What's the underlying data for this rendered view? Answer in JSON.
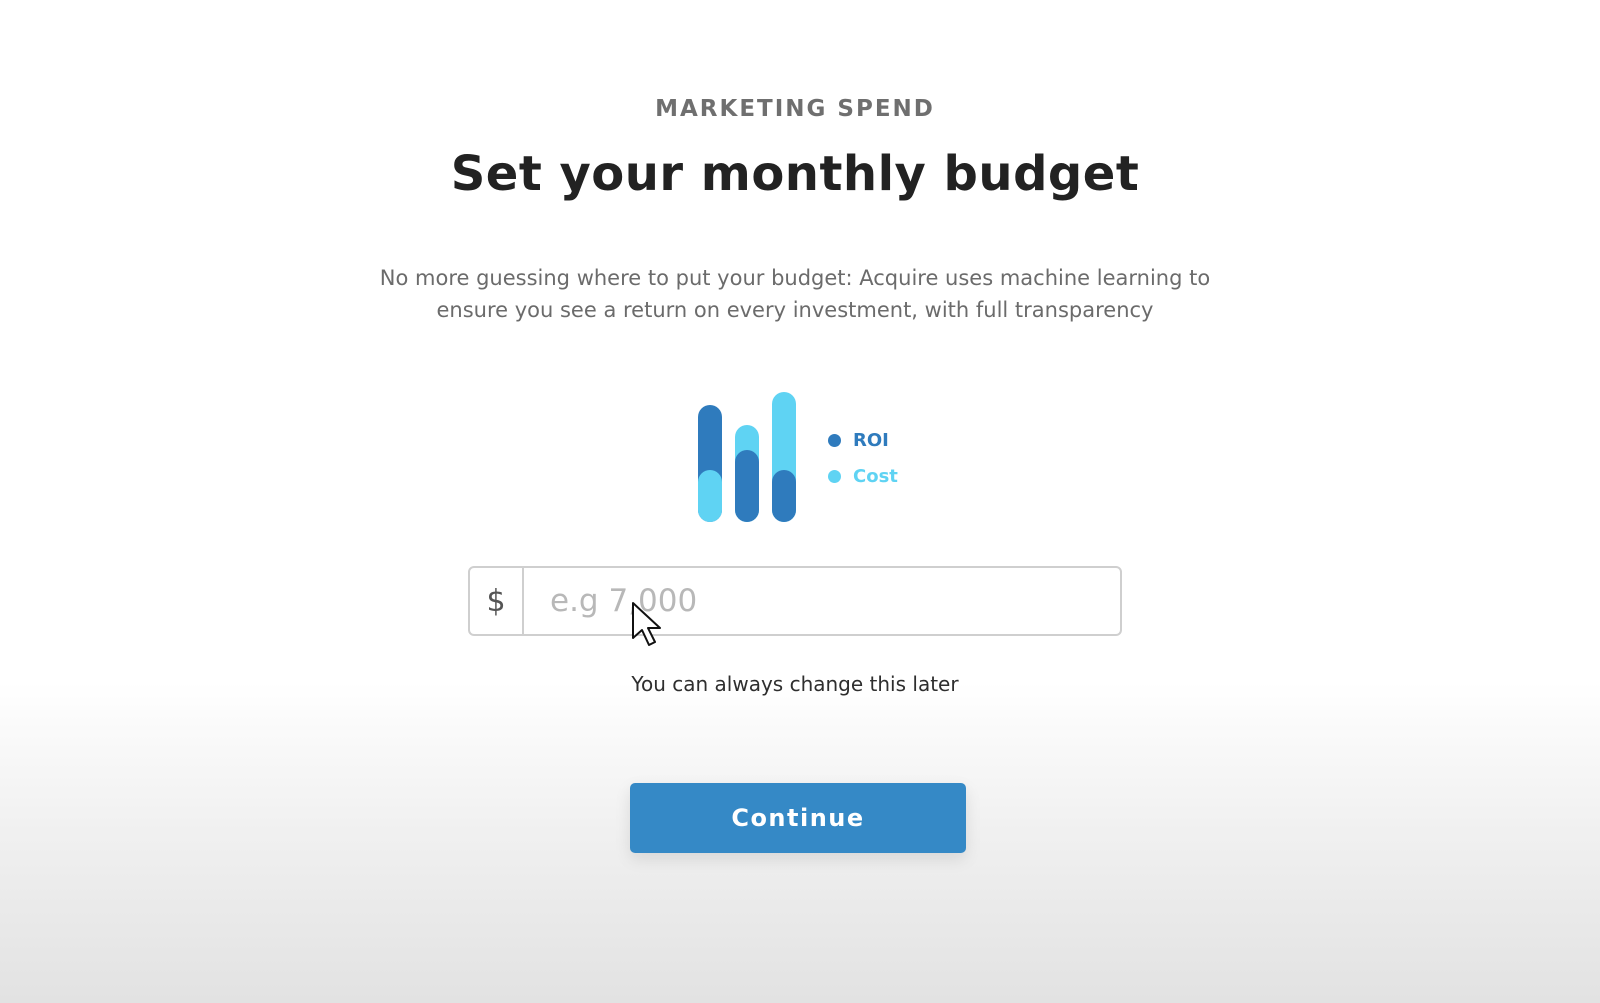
{
  "header": {
    "eyebrow": "MARKETING SPEND",
    "title": "Set your monthly budget"
  },
  "description": "No more guessing where to put your budget: Acquire uses machine learning to ensure you see a return on every investment, with full transparency",
  "illustration": {
    "legend": [
      {
        "label": "ROI",
        "color": "#2f7bbd"
      },
      {
        "label": "Cost",
        "color": "#5fd3f3"
      }
    ]
  },
  "budget_input": {
    "currency_symbol": "$",
    "placeholder": "e.g 7,000",
    "value": ""
  },
  "hint": "You can always change this later",
  "actions": {
    "continue_label": "Continue"
  },
  "colors": {
    "accent": "#3589c6",
    "roi": "#2f7bbd",
    "cost": "#5fd3f3"
  }
}
